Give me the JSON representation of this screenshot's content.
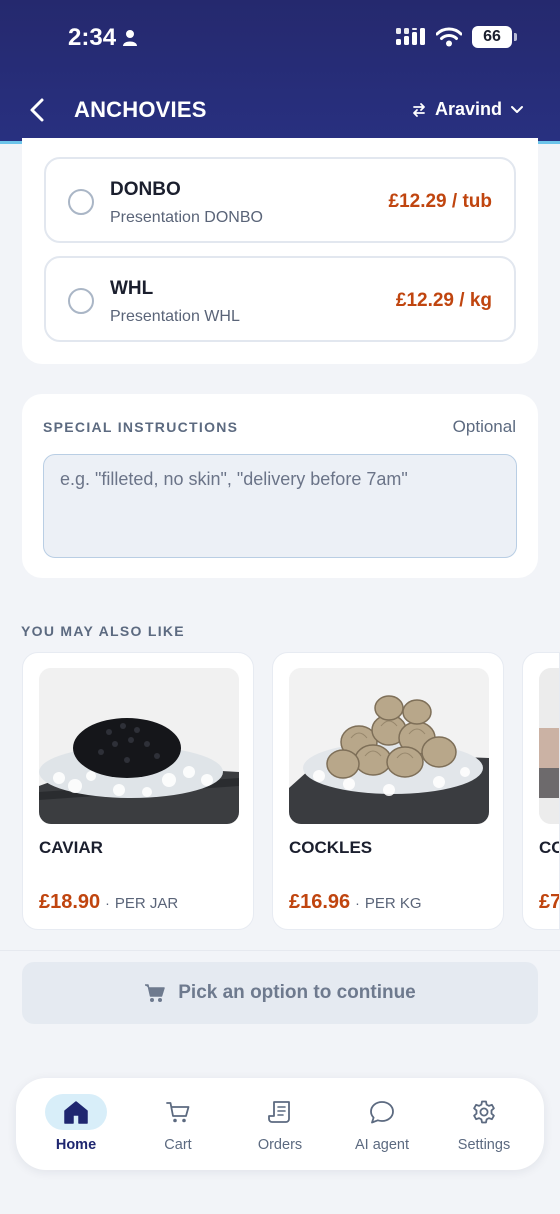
{
  "status_bar": {
    "time": "2:34",
    "battery": "66"
  },
  "header": {
    "title": "ANCHOVIES",
    "account_name": "Aravind"
  },
  "options": [
    {
      "name": "DONBO",
      "subtitle": "Presentation DONBO",
      "price": "£12.29 / tub"
    },
    {
      "name": "WHL",
      "subtitle": "Presentation WHL",
      "price": "£12.29 / kg"
    }
  ],
  "special_instructions": {
    "label": "SPECIAL INSTRUCTIONS",
    "optional": "Optional",
    "placeholder": "e.g. \"filleted, no skin\", \"delivery before 7am\""
  },
  "recommendations": {
    "label": "YOU MAY ALSO LIKE",
    "items": [
      {
        "name": "CAVIAR",
        "price": "£18.90",
        "separator": "·",
        "unit": "PER JAR"
      },
      {
        "name": "COCKLES",
        "price": "£16.96",
        "separator": "·",
        "unit": "PER KG"
      },
      {
        "name": "CO",
        "price": "£7",
        "separator": "",
        "unit": ""
      }
    ]
  },
  "cta": {
    "label": "Pick an option to continue"
  },
  "bottom_nav": [
    {
      "label": "Home",
      "icon": "home-icon",
      "active": true
    },
    {
      "label": "Cart",
      "icon": "cart-icon",
      "active": false
    },
    {
      "label": "Orders",
      "icon": "receipt-icon",
      "active": false
    },
    {
      "label": "AI agent",
      "icon": "chat-icon",
      "active": false
    },
    {
      "label": "Settings",
      "icon": "gear-icon",
      "active": false
    }
  ],
  "colors": {
    "header_bg": "#25296e",
    "accent_line": "#6cc4ea",
    "price": "#c0450f",
    "nav_active": "#1f2770",
    "nav_active_bg": "#d8eef9"
  }
}
